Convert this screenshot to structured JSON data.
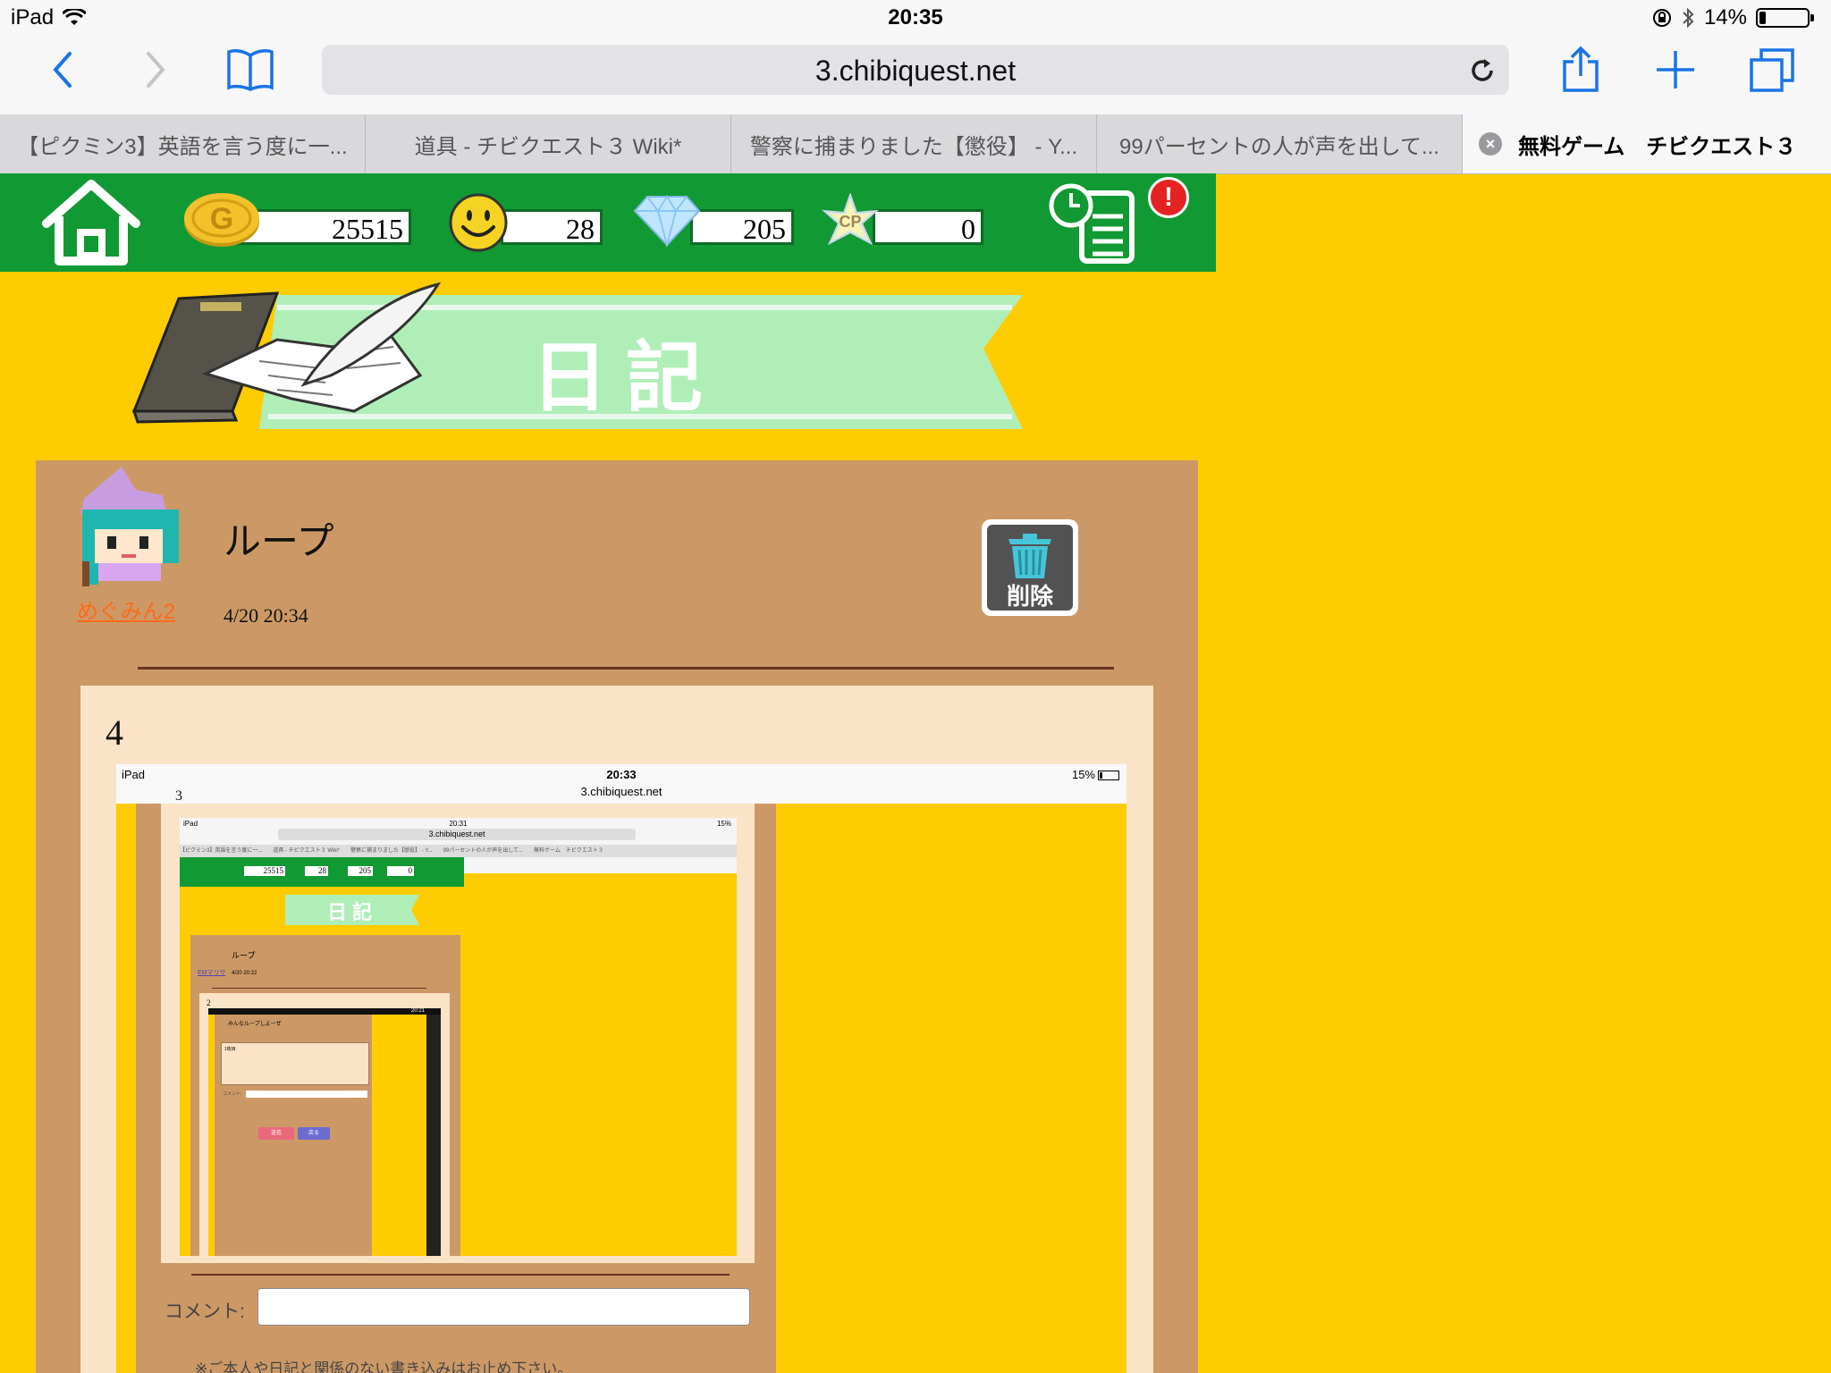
{
  "status_bar": {
    "device": "iPad",
    "time": "20:35",
    "battery": "14%",
    "battery_level": 0.14
  },
  "browser": {
    "url": "3.chibiquest.net",
    "tabs": [
      {
        "label": "【ピクミン3】英語を言う度に一..."
      },
      {
        "label": "道具 - チビクエスト３ Wiki*"
      },
      {
        "label": "警察に捕まりました【懲役】 - Y..."
      },
      {
        "label": "99パーセントの人が声を出して..."
      },
      {
        "label": "無料ゲーム　チビクエスト３",
        "active": true
      }
    ]
  },
  "game": {
    "gold": "25515",
    "smile": "28",
    "diamond": "205",
    "cp_label": "CP",
    "cp": "0",
    "alert": "!",
    "colors": {
      "header": "#119933",
      "background": "#ffcc00",
      "panel": "#cc9966",
      "content": "#fae3c6"
    }
  },
  "diary": {
    "banner": "日記",
    "entry": {
      "author": "めぐみん2",
      "title": "ループ",
      "date": "4/20 20:34",
      "delete_label": "削除",
      "body_number": "4"
    }
  },
  "embedded_screenshot": {
    "device": "iPad",
    "time": "20:33",
    "battery": "15%",
    "url": "3.chibiquest.net",
    "body_number": "3",
    "comment_label": "コメント:",
    "note": "※ご本人や日記と関係のない書き込みはお止め下さい。",
    "nested": {
      "device": "iPad",
      "time": "20:31",
      "battery": "15%",
      "url": "3.chibiquest.net",
      "tabs_text": "【ピクミン3】英語を言う度に一...　　道具 - チビクエスト３ Wiki*　　警察に捕まりました【懲役】 - Y...　　99パーセントの人が声を出して...　　無料ゲーム　チビクエスト３",
      "gold": "25515",
      "smile": "28",
      "diamond": "205",
      "cp": "0",
      "banner": "日記",
      "title": "ループ",
      "author": "EMマリサ",
      "date": "4/20 20:22",
      "body_number": "2",
      "inner": {
        "time": "20:21",
        "title": "みんなループしよーぜ",
        "box_text": "1枚目",
        "comment_label": "コメント:",
        "send_label": "送信",
        "back_label": "戻る"
      }
    }
  }
}
